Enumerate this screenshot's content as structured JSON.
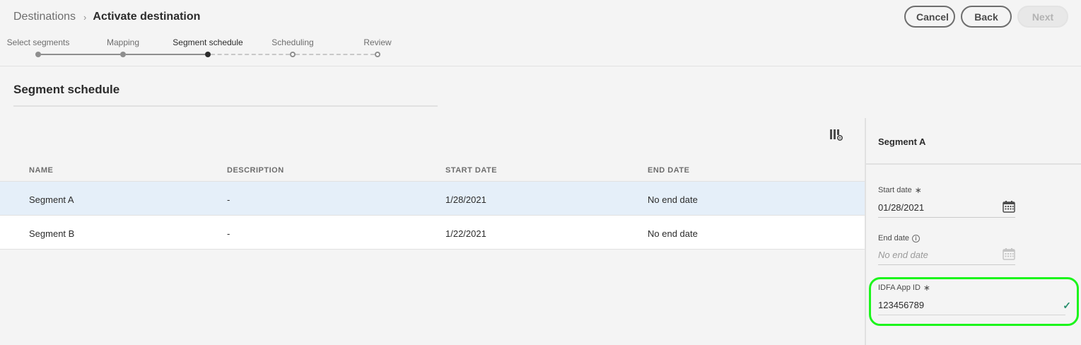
{
  "breadcrumb": {
    "root": "Destinations",
    "separator": "›",
    "current": "Activate destination"
  },
  "buttons": {
    "cancel": "Cancel",
    "back": "Back",
    "next": "Next"
  },
  "steps": [
    {
      "label": "Select segments",
      "state": "done"
    },
    {
      "label": "Mapping",
      "state": "done"
    },
    {
      "label": "Segment schedule",
      "state": "current"
    },
    {
      "label": "Scheduling",
      "state": "todo"
    },
    {
      "label": "Review",
      "state": "todo"
    }
  ],
  "section": {
    "title": "Segment schedule"
  },
  "table": {
    "headers": [
      "NAME",
      "DESCRIPTION",
      "START DATE",
      "END DATE"
    ],
    "rows": [
      {
        "name": "Segment A",
        "description": "-",
        "start_date": "1/28/2021",
        "end_date": "No end date",
        "selected": true
      },
      {
        "name": "Segment B",
        "description": "-",
        "start_date": "1/22/2021",
        "end_date": "No end date",
        "selected": false
      }
    ]
  },
  "rail": {
    "title": "Segment A",
    "start_date": {
      "label": "Start date",
      "required_mark": "∗",
      "value": "01/28/2021"
    },
    "end_date": {
      "label": "End date",
      "info": "i",
      "placeholder": "No end date"
    },
    "idfa": {
      "label": "IDFA App ID",
      "required_mark": "∗",
      "value": "123456789",
      "valid_mark": "✓"
    }
  },
  "colors": {
    "selected_row": "#e5eff9",
    "highlight": "#1cf51c",
    "valid": "#268e6c"
  },
  "icons": [
    "chevron-right-icon",
    "column-settings-icon",
    "calendar-icon",
    "info-icon",
    "checkmark-icon"
  ]
}
